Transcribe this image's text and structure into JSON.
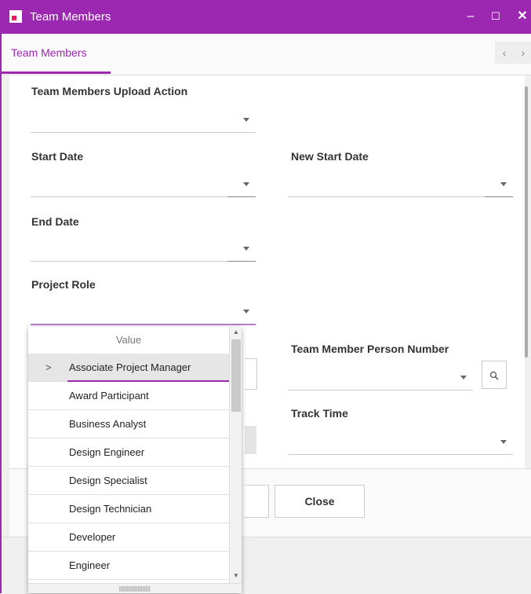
{
  "window": {
    "title": "Team Members",
    "minimize": "–",
    "maximize": "☐",
    "close": "✕"
  },
  "tabs": {
    "active": "Team Members",
    "prev": "‹",
    "next": "›"
  },
  "form": {
    "upload_action_label": "Team Members Upload Action",
    "start_date_label": "Start Date",
    "new_start_date_label": "New Start Date",
    "end_date_label": "End Date",
    "project_role_label": "Project Role",
    "person_number_label": "Team Member Person Number",
    "track_time_label": "Track Time"
  },
  "footer": {
    "close_label": "Close"
  },
  "dropdown": {
    "header": "Value",
    "options": [
      "Associate Project Manager",
      "Award Participant",
      "Business Analyst",
      "Design Engineer",
      "Design Specialist",
      "Design Technician",
      "Developer",
      "Engineer"
    ],
    "selected_index": 0
  },
  "icons": {
    "search": "search-icon",
    "chevron": "chevron-right-icon"
  },
  "colors": {
    "accent": "#9c27b0"
  }
}
